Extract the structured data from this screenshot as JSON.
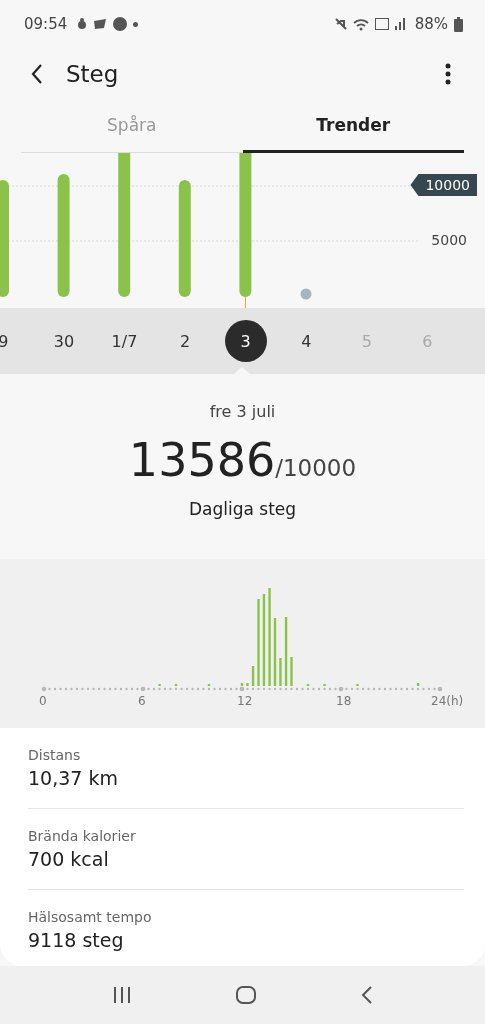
{
  "status_bar": {
    "time": "09:54",
    "battery": "88%"
  },
  "header": {
    "title": "Steg"
  },
  "tabs": [
    {
      "label": "Spåra",
      "selected": false
    },
    {
      "label": "Trender",
      "selected": true
    }
  ],
  "trend_chart": {
    "goal_label": "10000",
    "tick_label": "5000"
  },
  "dates": [
    {
      "label": "9",
      "selected": false,
      "future": false
    },
    {
      "label": "30",
      "selected": false,
      "future": false
    },
    {
      "label": "1/7",
      "selected": false,
      "future": false
    },
    {
      "label": "2",
      "selected": false,
      "future": false
    },
    {
      "label": "3",
      "selected": true,
      "future": false
    },
    {
      "label": "4",
      "selected": false,
      "future": false
    },
    {
      "label": "5",
      "selected": false,
      "future": true
    },
    {
      "label": "6",
      "selected": false,
      "future": true
    }
  ],
  "summary": {
    "date": "fre 3 juli",
    "steps": "13586",
    "goal": "/10000",
    "caption": "Dagliga steg"
  },
  "hourly": {
    "ticks": [
      "0",
      "6",
      "12",
      "18",
      "24(h)"
    ]
  },
  "stats": [
    {
      "label": "Distans",
      "value": "10,37 km"
    },
    {
      "label": "Brända kalorier",
      "value": "700 kcal"
    },
    {
      "label": "Hälsosamt tempo",
      "value": "9118 steg"
    }
  ]
}
